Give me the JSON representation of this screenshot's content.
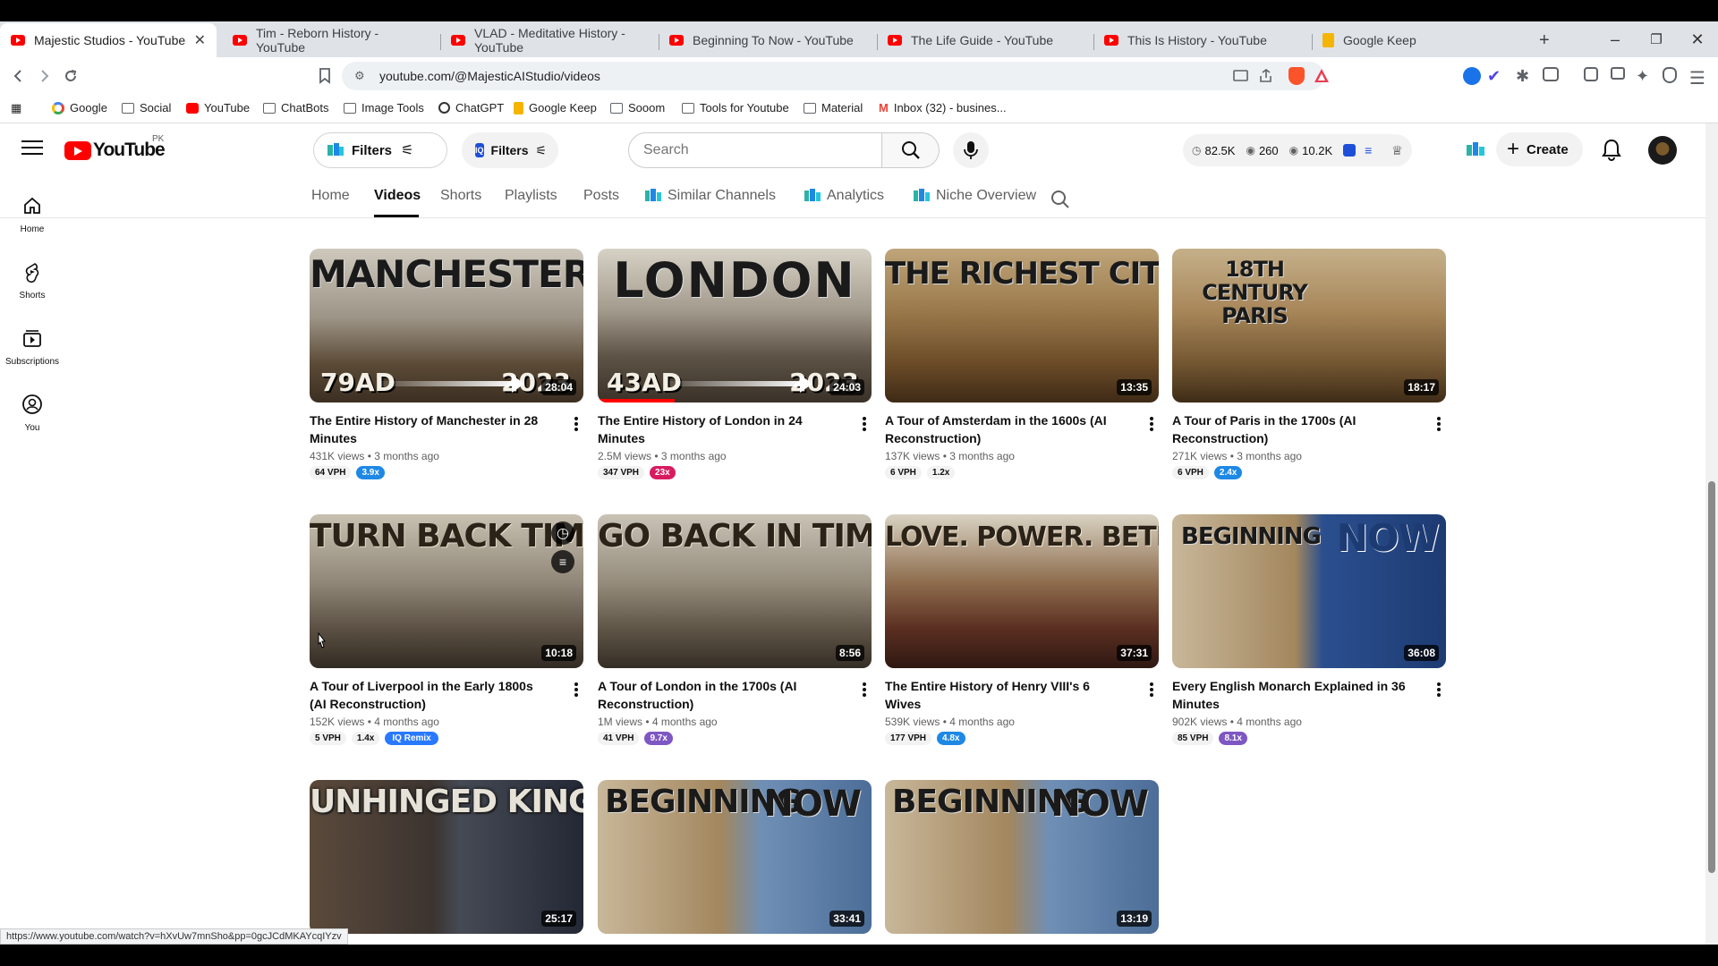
{
  "browser": {
    "tabs": [
      {
        "title": "Majestic Studios - YouTube",
        "active": true
      },
      {
        "title": "Tim - Reborn History - YouTube"
      },
      {
        "title": "VLAD - Meditative History - YouTube"
      },
      {
        "title": "Beginning To Now - YouTube"
      },
      {
        "title": "The Life Guide - YouTube"
      },
      {
        "title": "This Is History - YouTube"
      },
      {
        "title": "Google Keep"
      }
    ],
    "url": "youtube.com/@MajesticAIStudio/videos",
    "bookmarks": [
      "Google",
      "Social",
      "YouTube",
      "ChatBots",
      "Image Tools",
      "ChatGPT",
      "Google Keep",
      "Sooom",
      "Tools for Youtube",
      "Material",
      "Inbox (32) - busines..."
    ],
    "status_url": "https://www.youtube.com/watch?v=hXvUw7mnSho&pp=0gcJCdMKAYcqIYzv",
    "new_tab_label": "+",
    "close_label": "✕",
    "controls": {
      "minimize": "–",
      "restore": "❐",
      "close": "✕"
    }
  },
  "masthead": {
    "logo_text": "YouTube",
    "country_code": "PK",
    "filters_label_1": "Filters",
    "filters_label_2": "Filters",
    "search_placeholder": "Search",
    "stats": {
      "views": "82.5K",
      "videos": "260",
      "watch": "10.2K"
    },
    "create_label": "Create"
  },
  "guide": {
    "items": [
      {
        "label": "Home",
        "icon": "home-icon"
      },
      {
        "label": "Shorts",
        "icon": "shorts-icon"
      },
      {
        "label": "Subscriptions",
        "icon": "subscriptions-icon"
      },
      {
        "label": "You",
        "icon": "you-icon"
      }
    ]
  },
  "channel_tabs": [
    "Home",
    "Videos",
    "Shorts",
    "Playlists",
    "Posts",
    "Similar Channels",
    "Analytics",
    "Niche Overview"
  ],
  "active_channel_tab": "Videos",
  "colors": {
    "accent": "#ff0000",
    "vph_blue": "#1e88e5",
    "vph_pink": "#d81b60",
    "vph_purple": "#7e57c2"
  },
  "videos": [
    {
      "title": "The Entire History of Manchester in 28 Minutes",
      "meta": "431K views • 3 months ago",
      "duration": "28:04",
      "vph": "64 VPH",
      "mult": "3.9x",
      "mult_color": "#1e88e5",
      "thumb_text": "MANCHESTER",
      "thumb_left": "79AD",
      "thumb_right": "2023"
    },
    {
      "title": "The Entire History of London in 24 Minutes",
      "meta": "2.5M views • 3 months ago",
      "duration": "24:03",
      "vph": "347 VPH",
      "mult": "23x",
      "mult_color": "#d81b60",
      "thumb_text": "LONDON",
      "thumb_left": "43AD",
      "thumb_right": "2023",
      "watch_progress": 0.28
    },
    {
      "title": "A Tour of Amsterdam in the 1600s (AI Reconstruction)",
      "meta": "137K views • 3 months ago",
      "duration": "13:35",
      "vph": "6 VPH",
      "mult": "1.2x",
      "mult_color": "",
      "thumb_text": "THE RICHEST CITY"
    },
    {
      "title": "A Tour of Paris in the 1700s (AI Reconstruction)",
      "meta": "271K views • 3 months ago",
      "duration": "18:17",
      "vph": "6 VPH",
      "mult": "2.4x",
      "mult_color": "#1e88e5",
      "thumb_text": "18TH CENTURY PARIS"
    },
    {
      "title": "A Tour of Liverpool in the Early 1800s (AI Reconstruction)",
      "meta": "152K views • 4 months ago",
      "duration": "10:18",
      "vph": "5 VPH",
      "mult": "1.4x",
      "mult_color": "",
      "remix": "Remix",
      "thumb_text": "TURN BACK TIME"
    },
    {
      "title": "A Tour of London in the 1700s (AI Reconstruction)",
      "meta": "1M views • 4 months ago",
      "duration": "8:56",
      "vph": "41 VPH",
      "mult": "9.7x",
      "mult_color": "#7e57c2",
      "thumb_text": "GO BACK IN TIME"
    },
    {
      "title": "The Entire History of Henry VIII's 6 Wives",
      "meta": "539K views • 4 months ago",
      "duration": "37:31",
      "vph": "177 VPH",
      "mult": "4.8x",
      "mult_color": "#1e88e5",
      "thumb_text": "LOVE. POWER. BETRAYAL."
    },
    {
      "title": "Every English Monarch Explained in 36 Minutes",
      "meta": "902K views • 4 months ago",
      "duration": "36:08",
      "vph": "85 VPH",
      "mult": "8.1x",
      "mult_color": "#7e57c2",
      "thumb_text": "BEGINNING",
      "thumb_text2": "NOW"
    },
    {
      "title": "",
      "meta": "",
      "duration": "25:17",
      "thumb_text": "UNHINGED KINGS"
    },
    {
      "title": "",
      "meta": "",
      "duration": "33:41",
      "thumb_text": "BEGINNING",
      "thumb_text2": "NOW"
    },
    {
      "title": "",
      "meta": "",
      "duration": "13:19",
      "thumb_text": "BEGINNING",
      "thumb_text2": "NOW"
    }
  ]
}
